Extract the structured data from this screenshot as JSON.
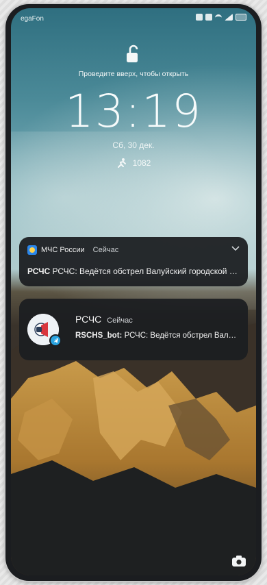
{
  "status_bar": {
    "carrier": "egaFon"
  },
  "lockscreen": {
    "unlock_hint": "Проведите вверх, чтобы открыть",
    "time": "13:19",
    "date": "Сб, 30 дек.",
    "steps": "1082"
  },
  "notifications": [
    {
      "app_name": "МЧС России",
      "time": "Сейчас",
      "sender": "РСЧС",
      "message": "РСЧС: Ведётся обстрел Валуйский городской округ"
    },
    {
      "title": "РСЧС",
      "time": "Сейчас",
      "sender": "RSCHS_bot:",
      "message": "РСЧС: Ведётся обстрел Валуйский городской округ"
    }
  ],
  "colors": {
    "card_bg": "#1c1e21",
    "app_icon_blue": "#2b86ea",
    "avatar_red": "#d9363e",
    "telegram_blue": "#2aa3e0"
  },
  "icons": [
    "unlock-icon",
    "running-icon",
    "chevron-down-icon",
    "megaphone-icon",
    "telegram-icon",
    "camera-icon"
  ]
}
